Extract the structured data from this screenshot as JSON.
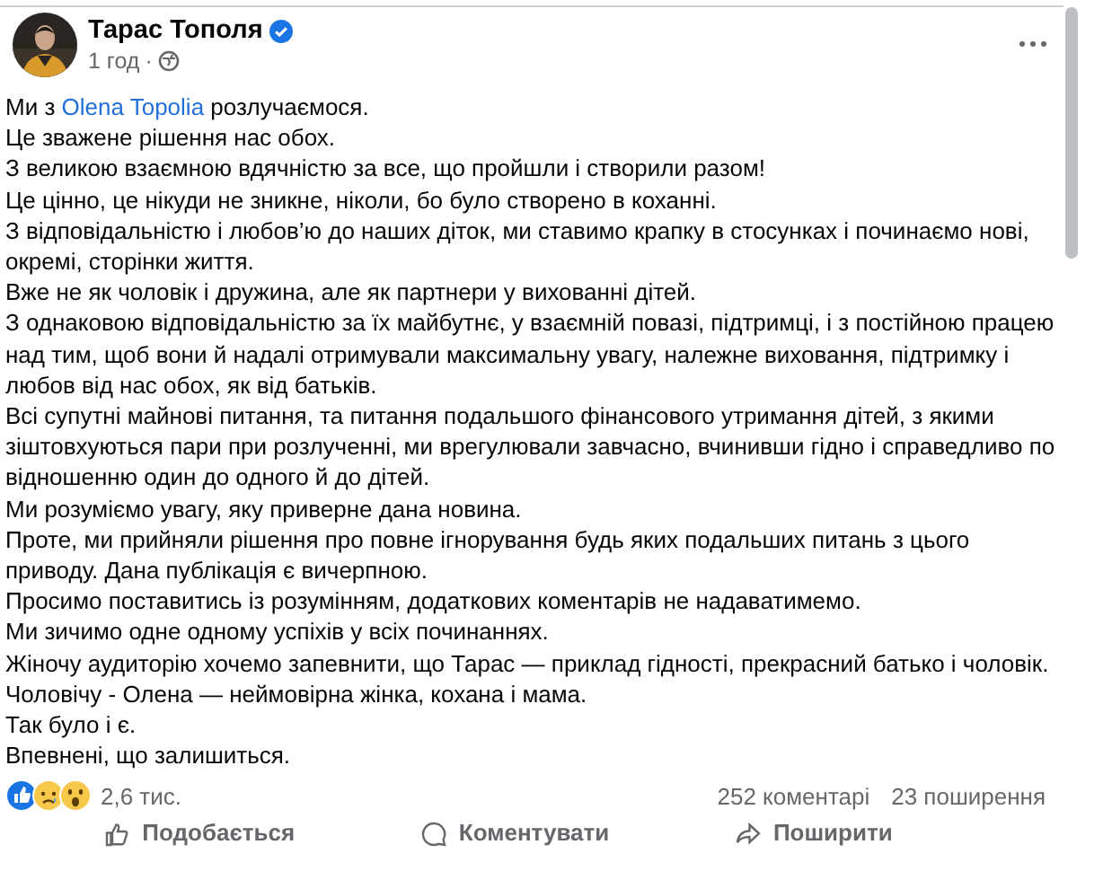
{
  "post": {
    "author": "Тарас Тополя",
    "verified": true,
    "time": "1 год",
    "separator": "·",
    "paragraphs": [
      {
        "kind": "mention",
        "before": "Ми з ",
        "mention": "Olena Topolia",
        "after": " розлучаємося."
      },
      {
        "kind": "text",
        "text": "Це зважене рішення нас обох."
      },
      {
        "kind": "text",
        "text": "З великою взаємною вдячністю за все, що пройшли і створили разом!"
      },
      {
        "kind": "text",
        "text": "Це цінно, це нікуди не зникне, ніколи, бо було створено в коханні."
      },
      {
        "kind": "text",
        "text": "З відповідальністю і любов’ю до наших діток, ми ставимо крапку в стосунках і починаємо нові, окремі, сторінки життя."
      },
      {
        "kind": "text",
        "text": "Вже не як чоловік і дружина, але як партнери у вихованні дітей."
      },
      {
        "kind": "text",
        "text": "З однаковою відповідальністю за їх майбутнє, у взаємній повазі, підтримці, і з постійною працею над тим, щоб вони й надалі отримували максимальну увагу, належне виховання, підтримку і любов від нас обох, як від батьків."
      },
      {
        "kind": "text",
        "text": "Всі супутні майнові питання, та питання подальшого фінансового утримання дітей, з якими зіштовхуються пари при розлученні, ми врегулювали завчасно, вчинивши гідно і справедливо по відношенню один до одного й до дітей."
      },
      {
        "kind": "text",
        "text": "Ми розуміємо увагу, яку приверне дана новина."
      },
      {
        "kind": "text",
        "text": "Проте, ми прийняли рішення про повне ігнорування будь яких подальших питань з цього приводу. Дана публікація є вичерпною."
      },
      {
        "kind": "text",
        "text": "Просимо поставитись із розумінням, додаткових коментарів не надаватимемо."
      },
      {
        "kind": "text",
        "text": "Ми зичимо одне одному успіхів у всіх починаннях."
      },
      {
        "kind": "text",
        "text": "Жіночу аудиторію хочемо запевнити, що Тарас — приклад гідності, прекрасний батько і чоловік."
      },
      {
        "kind": "text",
        "text": "Чоловічу - Олена — неймовірна жінка, кохана і мама."
      },
      {
        "kind": "text",
        "text": "Так було і є."
      },
      {
        "kind": "text",
        "text": "Впевнені, що залишиться."
      }
    ],
    "reactions": {
      "count": "2,6 тис.",
      "icons": [
        {
          "kind": "like"
        },
        {
          "kind": "sad"
        },
        {
          "kind": "wow"
        }
      ]
    },
    "comments": "252 коментарі",
    "shares": "23 поширення",
    "actions": [
      {
        "kind": "like",
        "label": "Подобається"
      },
      {
        "kind": "comment",
        "label": "Коментувати"
      },
      {
        "kind": "share",
        "label": "Поширити"
      }
    ]
  }
}
